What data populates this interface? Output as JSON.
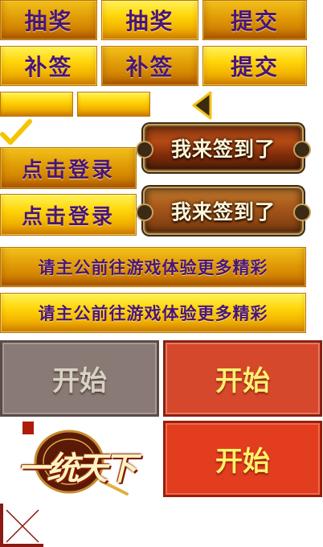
{
  "row1": {
    "draw_1": "抽奖",
    "draw_2": "抽奖",
    "submit_1": "提交"
  },
  "row2": {
    "resign_1": "补签",
    "resign_2": "补签",
    "submit_2": "提交"
  },
  "login": {
    "login_1": "点击登录",
    "login_2": "点击登录"
  },
  "checkin": {
    "checkin_1": "我来签到了",
    "checkin_2": "我来签到了"
  },
  "banner": {
    "text_1": "请主公前往游戏体验更多精彩",
    "text_2": "请主公前往游戏体验更多精彩"
  },
  "start": {
    "grey": "开始",
    "red_1": "开始",
    "red_2": "开始"
  },
  "logo": {
    "title": "一统天下"
  },
  "icons": {
    "check": "check-icon",
    "arrow": "triangle-left-icon",
    "close": "close-x-icon"
  },
  "colors": {
    "gold": "#ffd60a",
    "purple_text": "#4a1578",
    "red": "#d6482c",
    "grey": "#8a7a76",
    "check": "#f5c400"
  }
}
